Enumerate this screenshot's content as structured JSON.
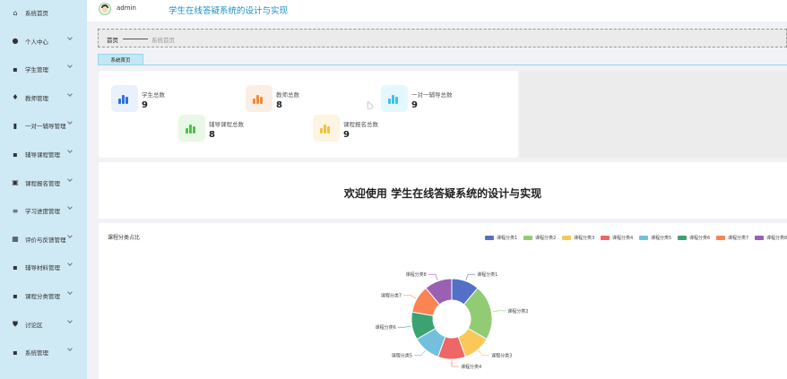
{
  "app": {
    "title": "学生在线答疑系统的设计与实现",
    "user": "admin"
  },
  "sidebar": {
    "items": [
      {
        "label": "系统首页",
        "icon": "home-icon",
        "chevron": false
      },
      {
        "label": "个人中心",
        "icon": "user-icon",
        "chevron": true
      },
      {
        "label": "学生管理",
        "icon": "grid-icon",
        "chevron": true
      },
      {
        "label": "教师管理",
        "icon": "lightbulb-icon",
        "chevron": true
      },
      {
        "label": "一对一辅导管理",
        "icon": "bar-chart-icon",
        "chevron": true
      },
      {
        "label": "辅导课程管理",
        "icon": "grid-icon",
        "chevron": true
      },
      {
        "label": "课程报名管理",
        "icon": "clipboard-icon",
        "chevron": true
      },
      {
        "label": "学习进度管理",
        "icon": "sliders-icon",
        "chevron": true
      },
      {
        "label": "评价与反馈管理",
        "icon": "table-icon",
        "chevron": true
      },
      {
        "label": "辅导材料管理",
        "icon": "grid-icon",
        "chevron": true
      },
      {
        "label": "课程分类管理",
        "icon": "grid-icon",
        "chevron": true
      },
      {
        "label": "讨论区",
        "icon": "shield-icon",
        "chevron": true
      },
      {
        "label": "系统管理",
        "icon": "grid-icon",
        "chevron": true
      }
    ]
  },
  "breadcrumb": {
    "home": "首页",
    "current": "系统首页"
  },
  "tabs": [
    {
      "label": "系统首页"
    }
  ],
  "stats": [
    {
      "label": "学生总数",
      "value": "9",
      "bg": "#e8f1fc",
      "bar": "#2f6fe0"
    },
    {
      "label": "教师总数",
      "value": "8",
      "bg": "#fdeee4",
      "bar": "#f08a3a"
    },
    {
      "label": "一对一辅导总数",
      "value": "9",
      "bg": "#e4f7fc",
      "bar": "#3cc2e8"
    },
    {
      "label": "辅导课程总数",
      "value": "8",
      "bg": "#e8f8e6",
      "bar": "#4fc24a"
    },
    {
      "label": "课程报名总数",
      "value": "9",
      "bg": "#fdf5e2",
      "bar": "#f0c23a"
    }
  ],
  "welcome": "欢迎使用 学生在线答疑系统的设计与实现",
  "chart_data": {
    "type": "pie",
    "title": "课程分类占比",
    "legend_position": "top-right",
    "categories": [
      "课程分类1",
      "课程分类2",
      "课程分类3",
      "课程分类4",
      "课程分类5",
      "课程分类6",
      "课程分类7",
      "课程分类8"
    ],
    "values": [
      1,
      2,
      1,
      1,
      1,
      1,
      1,
      1
    ],
    "colors": [
      "#5470c6",
      "#91cc75",
      "#fac858",
      "#ee6666",
      "#73c0de",
      "#3ba272",
      "#fc8452",
      "#9a60b4"
    ]
  }
}
